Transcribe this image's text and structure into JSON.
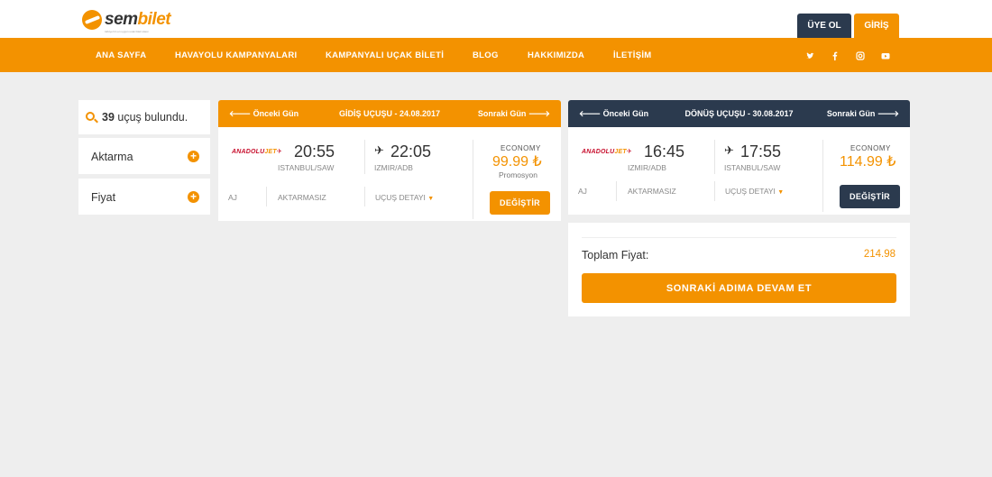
{
  "header": {
    "logo": {
      "text_main": "sem",
      "text_accent": "bilet",
      "tagline": "türkiye'nin en uygun ucak bileti sitesi"
    },
    "register_label": "ÜYE OL",
    "login_label": "GİRİŞ"
  },
  "nav": {
    "items": [
      "ANA SAYFA",
      "HAVAYOLU KAMPANYALARI",
      "KAMPANYALI UÇAK BİLETİ",
      "BLOG",
      "HAKKIMIZDA",
      "İLETİŞİM"
    ],
    "social": [
      "twitter-icon",
      "facebook-icon",
      "instagram-icon",
      "youtube-icon"
    ]
  },
  "sidebar": {
    "found_count": "39",
    "found_text": "uçuş bulundu.",
    "filters": [
      "Aktarma",
      "Fiyat"
    ]
  },
  "outbound": {
    "prev_label": "Önceki Gün",
    "title": "GİDİŞ UÇUŞU - 24.08.2017",
    "next_label": "Sonraki Gün",
    "airline": {
      "part1": "ANADOLU",
      "part2": "JET"
    },
    "depart_time": "20:55",
    "depart_airport": "ISTANBUL/SAW",
    "arrive_time": "22:05",
    "arrive_airport": "IZMIR/ADB",
    "code": "AJ",
    "transfer": "AKTARMASIZ",
    "detail_label": "UÇUŞ DETAYI",
    "cabin": "ECONOMY",
    "price": "99.99 ₺",
    "promo": "Promosyon",
    "change_label": "DEĞİŞTİR"
  },
  "return": {
    "prev_label": "Önceki Gün",
    "title": "DÖNÜŞ UÇUŞU - 30.08.2017",
    "next_label": "Sonraki Gün",
    "airline": {
      "part1": "ANADOLU",
      "part2": "JET"
    },
    "depart_time": "16:45",
    "depart_airport": "IZMIR/ADB",
    "arrive_time": "17:55",
    "arrive_airport": "ISTANBUL/SAW",
    "code": "AJ",
    "transfer": "AKTARMASIZ",
    "detail_label": "UÇUŞ DETAYI",
    "cabin": "ECONOMY",
    "price": "114.99 ₺",
    "change_label": "DEĞİŞTİR"
  },
  "summary": {
    "total_label": "Toplam Fiyat:",
    "total_value": "214.98",
    "continue_label": "SONRAKİ ADIMA DEVAM ET"
  },
  "colors": {
    "brand": "#f39200",
    "dark": "#2b3a4e",
    "background": "#eeeeee"
  }
}
